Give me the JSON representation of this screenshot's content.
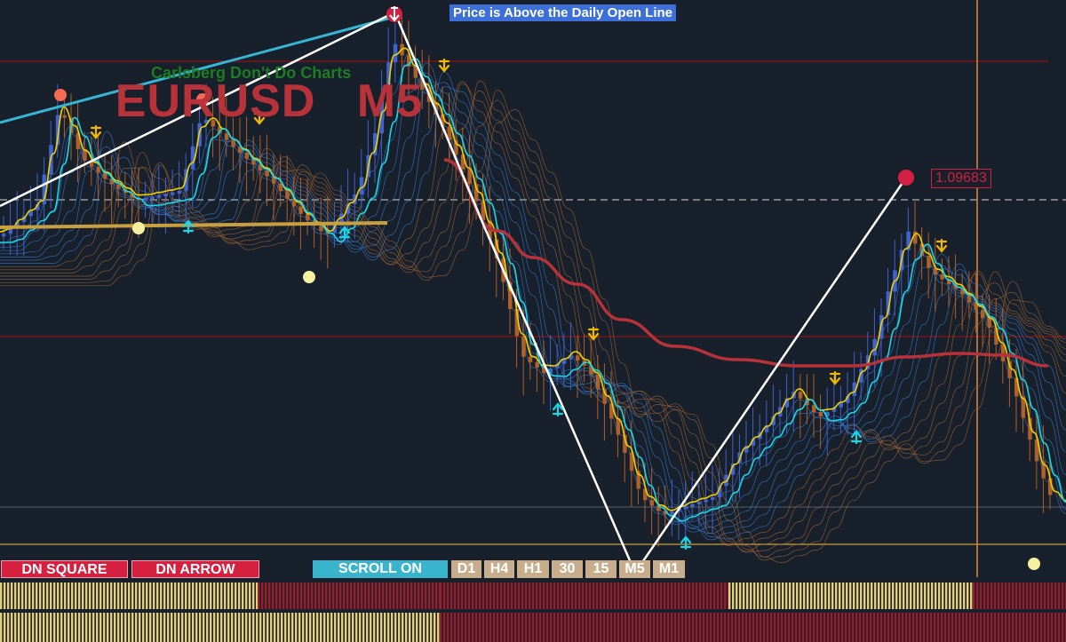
{
  "window": {
    "symbol": "EURUSD",
    "timeframe": "M5",
    "subtitle": "Carlsberg Don't Do Charts"
  },
  "banner": {
    "text": "Price is Above the Daily Open Line"
  },
  "price_label": {
    "value": "1.09683"
  },
  "buttons": {
    "dn_square": "DN SQUARE",
    "dn_arrow": "DN ARROW",
    "scroll": "SCROLL ON"
  },
  "timeframes": [
    "D1",
    "H4",
    "H1",
    "30",
    "15",
    "M5",
    "M1"
  ],
  "colors": {
    "background": "#17202b",
    "bull_candle": "#3d63d6",
    "bear_candle": "#b0602a",
    "fast_ma": "#19d7e6",
    "slow_ma": "#f0d000",
    "long_ma": "#b8323a",
    "zigzag": "#ffffff",
    "signal_up": "#19d7e6",
    "signal_down": "#f0b800",
    "resistance_line": "#8a1414",
    "daily_open_line": "#c9a040",
    "price_marker": "#d32042",
    "button_red": "#d5203f",
    "button_scroll": "#3ab3cc",
    "button_timeframe": "#c7ad8b",
    "strip_bull": "#e6d07a",
    "strip_bear": "#9b1e2a"
  },
  "icons": {
    "down_signal": "arrow-down-icon",
    "up_signal": "arrow-up-icon",
    "swing_high": "circle-marker-icon",
    "swing_low": "circle-marker-icon"
  }
}
